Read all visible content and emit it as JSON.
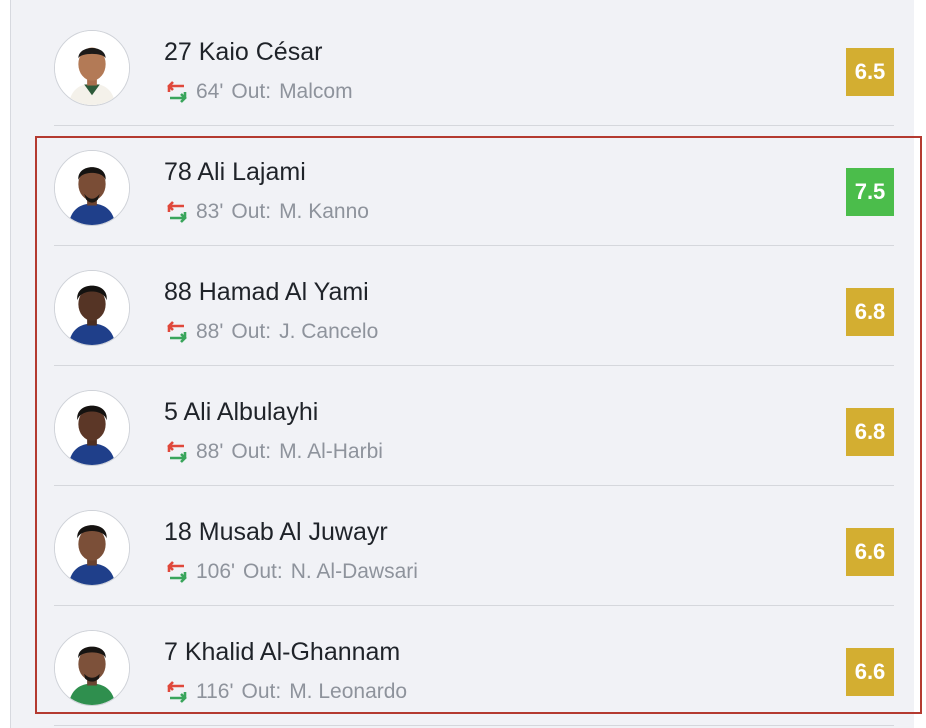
{
  "colors": {
    "panel_bg": "#f1f2f6",
    "rating_default": "#d3ae31",
    "rating_high": "#4bbd4b",
    "highlight_border": "#b43a30",
    "sub_arrow_out": "#e0483b",
    "sub_arrow_in": "#3aa55c"
  },
  "players": [
    {
      "name": "27 Kaio César",
      "sub_minute": "64'",
      "sub_out_label": "Out:",
      "sub_out_name": "Malcom",
      "rating": "6.5",
      "rating_color": "#d3ae31",
      "icon": "player-avatar"
    },
    {
      "name": "78 Ali Lajami",
      "sub_minute": "83'",
      "sub_out_label": "Out:",
      "sub_out_name": "M. Kanno",
      "rating": "7.5",
      "rating_color": "#4bbd4b",
      "icon": "player-avatar"
    },
    {
      "name": "88 Hamad Al Yami",
      "sub_minute": "88'",
      "sub_out_label": "Out:",
      "sub_out_name": "J. Cancelo",
      "rating": "6.8",
      "rating_color": "#d3ae31",
      "icon": "player-avatar"
    },
    {
      "name": "5 Ali Albulayhi",
      "sub_minute": "88'",
      "sub_out_label": "Out:",
      "sub_out_name": "M. Al-Harbi",
      "rating": "6.8",
      "rating_color": "#d3ae31",
      "icon": "player-avatar"
    },
    {
      "name": "18 Musab Al Juwayr",
      "sub_minute": "106'",
      "sub_out_label": "Out:",
      "sub_out_name": "N. Al-Dawsari",
      "rating": "6.6",
      "rating_color": "#d3ae31",
      "icon": "player-avatar"
    },
    {
      "name": "7 Khalid Al-Ghannam",
      "sub_minute": "116'",
      "sub_out_label": "Out:",
      "sub_out_name": "M. Leonardo",
      "rating": "6.6",
      "rating_color": "#d3ae31",
      "icon": "player-avatar"
    }
  ]
}
